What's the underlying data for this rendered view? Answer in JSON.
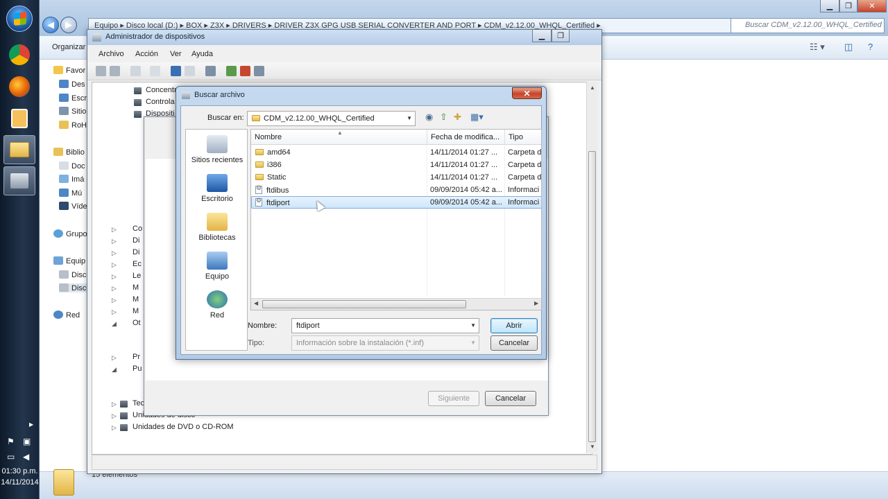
{
  "explorer": {
    "breadcrumb": [
      "Equipo",
      "Disco local (D:)",
      "BOX",
      "Z3X",
      "DRIVERS",
      "DRIVER Z3X GPG USB SERIAL CONVERTER AND PORT",
      "CDM_v2.12.00_WHQL_Certified"
    ],
    "search_placeholder": "Buscar CDM_v2.12.00_WHQL_Certified",
    "organize_label": "Organizar",
    "nav_items": [
      "Favor",
      "Des",
      "Escr",
      "Sitio",
      "RoH",
      "Biblio",
      "Doc",
      "Imá",
      "Mú",
      "Víde",
      "Grupo",
      "Equip",
      "Disco",
      "Disco",
      "Red"
    ],
    "status": "15 elementos"
  },
  "taskbar": {
    "time": "01:30 p.m.",
    "date": "14/11/2014"
  },
  "device_manager": {
    "title": "Administrador de dispositivos",
    "menu": [
      "Archivo",
      "Acción",
      "Ver",
      "Ayuda"
    ],
    "tree_top": [
      "Concentr",
      "Controla",
      "Dispositi"
    ],
    "tree_bottom": [
      "Teclados",
      "Unidades de disco",
      "Unidades de DVD o CD-ROM"
    ],
    "tree_partial": [
      "Co",
      "Di",
      "Di",
      "Ec",
      "Le",
      "M",
      "M",
      "M",
      "Ot",
      "Pr",
      "Pu"
    ]
  },
  "wizard": {
    "next_label": "Siguiente",
    "cancel_label": "Cancelar"
  },
  "file_dialog": {
    "title": "Buscar archivo",
    "look_in_label": "Buscar en:",
    "look_in_value": "CDM_v2.12.00_WHQL_Certified",
    "places": [
      "Sitios recientes",
      "Escritorio",
      "Bibliotecas",
      "Equipo",
      "Red"
    ],
    "columns": [
      "Nombre",
      "Fecha de modifica...",
      "Tipo"
    ],
    "files": [
      {
        "name": "amd64",
        "date": "14/11/2014 01:27 ...",
        "type": "Carpeta d",
        "kind": "folder"
      },
      {
        "name": "i386",
        "date": "14/11/2014 01:27 ...",
        "type": "Carpeta d",
        "kind": "folder"
      },
      {
        "name": "Static",
        "date": "14/11/2014 01:27 ...",
        "type": "Carpeta d",
        "kind": "folder"
      },
      {
        "name": "ftdibus",
        "date": "09/09/2014 05:42 a...",
        "type": "Informaci",
        "kind": "inf"
      },
      {
        "name": "ftdiport",
        "date": "09/09/2014 05:42 a...",
        "type": "Informaci",
        "kind": "inf",
        "selected": true
      }
    ],
    "filename_label": "Nombre:",
    "filename_value": "ftdiport",
    "filetype_label": "Tipo:",
    "filetype_value": "Información sobre la instalación (*.inf)",
    "open_label": "Abrir",
    "cancel_label": "Cancelar",
    "close_glyph": "✕"
  }
}
